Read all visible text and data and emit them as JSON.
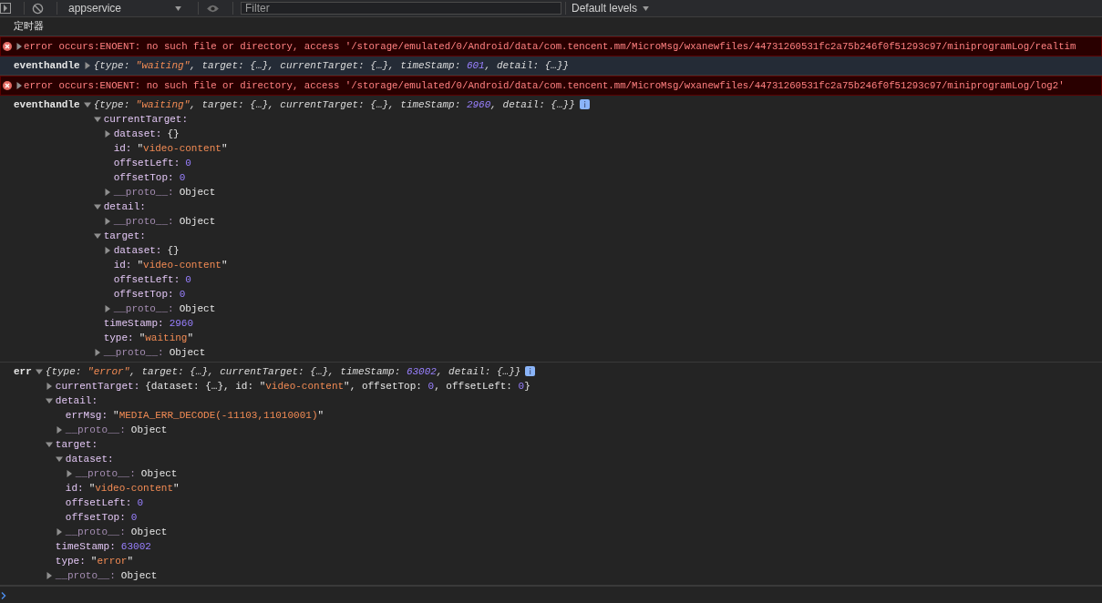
{
  "toolbar": {
    "context": "appservice",
    "filter": {
      "placeholder": "Filter"
    },
    "levels": "Default levels"
  },
  "messages": [
    {
      "kind": "text",
      "text": "定时器"
    },
    {
      "kind": "error",
      "expanded": false,
      "text": "error occurs:ENOENT: no such file or directory, access '/storage/emulated/0/Android/data/com.tencent.mm/MicroMsg/wxanewfiles/44731260531fc2a75b246f0f51293c97/miniprogramLog/realtim"
    },
    {
      "kind": "object",
      "label": "eventhandle",
      "expanded": false,
      "highlighted": true,
      "preview": [
        {
          "kind": "plain",
          "text": "{type: "
        },
        {
          "kind": "string",
          "text": "\"waiting\""
        },
        {
          "kind": "plain",
          "text": ", target: {…}, currentTarget: {…}, timeStamp: "
        },
        {
          "kind": "number",
          "text": "601"
        },
        {
          "kind": "plain",
          "text": ", detail: {…}}"
        }
      ]
    },
    {
      "kind": "error",
      "expanded": false,
      "text": "error occurs:ENOENT: no such file or directory, access '/storage/emulated/0/Android/data/com.tencent.mm/MicroMsg/wxanewfiles/44731260531fc2a75b246f0f51293c97/miniprogramLog/log2'"
    },
    {
      "kind": "object",
      "label": "eventhandle",
      "expanded": true,
      "highlighted": false,
      "preview": [
        {
          "kind": "plain",
          "text": "{type: "
        },
        {
          "kind": "string",
          "text": "\"waiting\""
        },
        {
          "kind": "plain",
          "text": ", target: {…}, currentTarget: {…}, timeStamp: "
        },
        {
          "kind": "number",
          "text": "2960"
        },
        {
          "kind": "plain",
          "text": ", detail: {…}}"
        }
      ],
      "properties": [
        {
          "key": "currentTarget:",
          "internal": false,
          "expanded": true,
          "children": [
            {
              "key": "dataset:",
              "internal": false,
              "expanded": false,
              "value": [
                {
                  "kind": "plain",
                  "text": "{}"
                }
              ]
            },
            {
              "key": "id:",
              "internal": false,
              "value": [
                {
                  "kind": "plain",
                  "text": "\""
                },
                {
                  "kind": "string",
                  "text": "video-content"
                },
                {
                  "kind": "plain",
                  "text": "\""
                }
              ]
            },
            {
              "key": "offsetLeft:",
              "internal": false,
              "value": [
                {
                  "kind": "number",
                  "text": "0"
                }
              ]
            },
            {
              "key": "offsetTop:",
              "internal": false,
              "value": [
                {
                  "kind": "number",
                  "text": "0"
                }
              ]
            },
            {
              "key": "__proto__:",
              "internal": true,
              "expanded": false,
              "value": [
                {
                  "kind": "plain",
                  "text": "Object"
                }
              ]
            }
          ]
        },
        {
          "key": "detail:",
          "internal": false,
          "expanded": true,
          "children": [
            {
              "key": "__proto__:",
              "internal": true,
              "expanded": false,
              "value": [
                {
                  "kind": "plain",
                  "text": "Object"
                }
              ]
            }
          ]
        },
        {
          "key": "target:",
          "internal": false,
          "expanded": true,
          "children": [
            {
              "key": "dataset:",
              "internal": false,
              "expanded": false,
              "value": [
                {
                  "kind": "plain",
                  "text": "{}"
                }
              ]
            },
            {
              "key": "id:",
              "internal": false,
              "value": [
                {
                  "kind": "plain",
                  "text": "\""
                },
                {
                  "kind": "string",
                  "text": "video-content"
                },
                {
                  "kind": "plain",
                  "text": "\""
                }
              ]
            },
            {
              "key": "offsetLeft:",
              "internal": false,
              "value": [
                {
                  "kind": "number",
                  "text": "0"
                }
              ]
            },
            {
              "key": "offsetTop:",
              "internal": false,
              "value": [
                {
                  "kind": "number",
                  "text": "0"
                }
              ]
            },
            {
              "key": "__proto__:",
              "internal": true,
              "expanded": false,
              "value": [
                {
                  "kind": "plain",
                  "text": "Object"
                }
              ]
            }
          ]
        },
        {
          "key": "timeStamp:",
          "internal": false,
          "value": [
            {
              "kind": "number",
              "text": "2960"
            }
          ]
        },
        {
          "key": "type:",
          "internal": false,
          "value": [
            {
              "kind": "plain",
              "text": "\""
            },
            {
              "kind": "string",
              "text": "waiting"
            },
            {
              "kind": "plain",
              "text": "\""
            }
          ]
        },
        {
          "key": "__proto__:",
          "internal": true,
          "expanded": false,
          "value": [
            {
              "kind": "plain",
              "text": "Object"
            }
          ]
        }
      ]
    },
    {
      "kind": "object",
      "label": "err",
      "expanded": true,
      "highlighted": false,
      "preview": [
        {
          "kind": "plain",
          "text": "{type: "
        },
        {
          "kind": "string",
          "text": "\"error\""
        },
        {
          "kind": "plain",
          "text": ", target: {…}, currentTarget: {…}, timeStamp: "
        },
        {
          "kind": "number",
          "text": "63002"
        },
        {
          "kind": "plain",
          "text": ", detail: {…}}"
        }
      ],
      "properties": [
        {
          "key": "currentTarget:",
          "internal": false,
          "expanded": false,
          "value": [
            {
              "kind": "plain",
              "text": "{dataset: {…}, id: \""
            },
            {
              "kind": "string",
              "text": "video-content"
            },
            {
              "kind": "plain",
              "text": "\", offsetTop: "
            },
            {
              "kind": "number",
              "text": "0"
            },
            {
              "kind": "plain",
              "text": ", offsetLeft: "
            },
            {
              "kind": "number",
              "text": "0"
            },
            {
              "kind": "plain",
              "text": "}"
            }
          ]
        },
        {
          "key": "detail:",
          "internal": false,
          "expanded": true,
          "children": [
            {
              "key": "errMsg:",
              "internal": false,
              "value": [
                {
                  "kind": "plain",
                  "text": "\""
                },
                {
                  "kind": "string",
                  "text": "MEDIA_ERR_DECODE(-11103,11010001)"
                },
                {
                  "kind": "plain",
                  "text": "\""
                }
              ]
            },
            {
              "key": "__proto__:",
              "internal": true,
              "expanded": false,
              "value": [
                {
                  "kind": "plain",
                  "text": "Object"
                }
              ]
            }
          ]
        },
        {
          "key": "target:",
          "internal": false,
          "expanded": true,
          "children": [
            {
              "key": "dataset:",
              "internal": false,
              "expanded": true,
              "children": [
                {
                  "key": "__proto__:",
                  "internal": true,
                  "expanded": false,
                  "value": [
                    {
                      "kind": "plain",
                      "text": "Object"
                    }
                  ]
                }
              ]
            },
            {
              "key": "id:",
              "internal": false,
              "value": [
                {
                  "kind": "plain",
                  "text": "\""
                },
                {
                  "kind": "string",
                  "text": "video-content"
                },
                {
                  "kind": "plain",
                  "text": "\""
                }
              ]
            },
            {
              "key": "offsetLeft:",
              "internal": false,
              "value": [
                {
                  "kind": "number",
                  "text": "0"
                }
              ]
            },
            {
              "key": "offsetTop:",
              "internal": false,
              "value": [
                {
                  "kind": "number",
                  "text": "0"
                }
              ]
            },
            {
              "key": "__proto__:",
              "internal": true,
              "expanded": false,
              "value": [
                {
                  "kind": "plain",
                  "text": "Object"
                }
              ]
            }
          ]
        },
        {
          "key": "timeStamp:",
          "internal": false,
          "value": [
            {
              "kind": "number",
              "text": "63002"
            }
          ]
        },
        {
          "key": "type:",
          "internal": false,
          "value": [
            {
              "kind": "plain",
              "text": "\""
            },
            {
              "kind": "string",
              "text": "error"
            },
            {
              "kind": "plain",
              "text": "\""
            }
          ]
        },
        {
          "key": "__proto__:",
          "internal": true,
          "expanded": false,
          "value": [
            {
              "kind": "plain",
              "text": "Object"
            }
          ]
        }
      ]
    }
  ]
}
